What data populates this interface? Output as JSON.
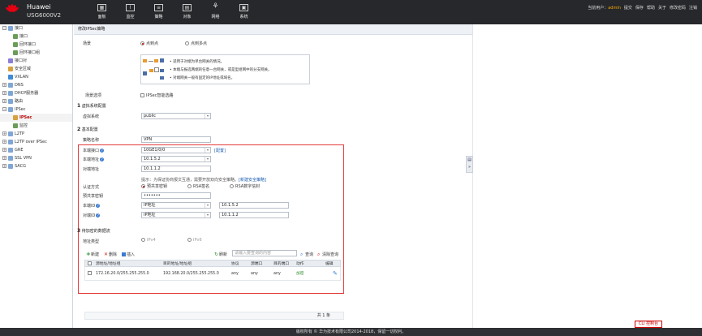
{
  "header": {
    "brand": "Huawei",
    "model": "USG6000V2",
    "nav": [
      {
        "label": "面板",
        "icon": "dashboard-icon"
      },
      {
        "label": "监控",
        "icon": "monitor-icon"
      },
      {
        "label": "策略",
        "icon": "policy-icon"
      },
      {
        "label": "对象",
        "icon": "object-icon"
      },
      {
        "label": "网络",
        "icon": "network-icon"
      },
      {
        "label": "系统",
        "icon": "system-icon"
      }
    ],
    "user_label": "当前用户：",
    "user_name": "admin",
    "links": [
      "提交",
      "保存",
      "帮助",
      "关于",
      "修改密码",
      "注销"
    ]
  },
  "sidebar": {
    "items": [
      {
        "label": "接口",
        "level": 0
      },
      {
        "label": "接口",
        "level": 1
      },
      {
        "label": "回环接口",
        "level": 1
      },
      {
        "label": "回环接口组",
        "level": 1
      },
      {
        "label": "接口对",
        "level": 0
      },
      {
        "label": "安全区域",
        "level": 0
      },
      {
        "label": "VXLAN",
        "level": 0
      },
      {
        "label": "DNS",
        "level": 0
      },
      {
        "label": "DHCP服务器",
        "level": 0
      },
      {
        "label": "路由",
        "level": 0
      },
      {
        "label": "IPSec",
        "level": 0
      },
      {
        "label": "IPSec",
        "level": 1
      },
      {
        "label": "监控",
        "level": 1
      },
      {
        "label": "L2TP",
        "level": 0
      },
      {
        "label": "L2TP over IPSec",
        "level": 0
      },
      {
        "label": "GRE",
        "level": 0
      },
      {
        "label": "SSL VPN",
        "level": 0
      },
      {
        "label": "SACG",
        "level": 0
      }
    ]
  },
  "form": {
    "panel_title": "修改IPSec策略",
    "scene_label": "场景",
    "scene_option1": "点到点",
    "scene_option2": "点到多点",
    "scene_desc": [
      "适用于对端为单台网关的情况。",
      "本端与报选两端的任意一台网关，或是型组网中的分支网关。",
      "对端网关一般有固定的IP地址或域名。"
    ],
    "scene_option_label": "场景选项",
    "smart_route_label": "IPSec智能选路",
    "section1": "虚拟系统配置",
    "vsys_label": "虚拟系统",
    "vsys_value": "public",
    "section2": "基本配置",
    "policy_name_label": "策略名称",
    "policy_name_value": "VPN",
    "local_if_label": "本端接口",
    "local_if_value": "10GE1/0/0",
    "config_link": "[配置]",
    "local_addr_label": "本端地址",
    "local_addr_value": "10.1.5.2",
    "peer_addr_label": "对端地址",
    "peer_addr_value": "10.1.1.2",
    "hint_text": "提示：为保证协商报文互通，需要开放双向安全策略。",
    "new_policy_link": "[新建安全策略]",
    "auth_label": "认证方式",
    "auth_options": [
      "预共享密钥",
      "RSA签名",
      "RSA数字信封"
    ],
    "psk_label": "预共享密钥",
    "psk_value": "•••••••",
    "local_id_label": "本端ID",
    "local_id_type": "IP地址",
    "local_id_value": "10.1.5.2",
    "peer_id_label": "对端ID",
    "peer_id_type": "IP地址",
    "peer_id_value": "10.1.1.2",
    "section3": "待加密的数据流",
    "addr_type_label": "地址类型",
    "addr_type_options": [
      "IPv4",
      "IPv6"
    ],
    "section_numbers": [
      "1",
      "2",
      "3"
    ]
  },
  "table": {
    "toolbar": {
      "new": "新建",
      "delete": "删除",
      "insert": "插入",
      "refresh": "刷新",
      "search_placeholder": "请输入要查询的内容",
      "query": "查询",
      "clear": "清除查询"
    },
    "columns": [
      "源地址/地址组",
      "目的地址/地址组",
      "协议",
      "源端口",
      "目的端口",
      "动作",
      "编辑"
    ],
    "rows": [
      {
        "src": "172.16.20.0/255.255.255.0",
        "dst": "192.168.20.0/255.255.255.0",
        "proto": "any",
        "sport": "any",
        "dport": "any",
        "action": "加密"
      }
    ],
    "footer": "共 1 条"
  },
  "footer_text": "版权所有 © 华为技术有限公司2014-2018，保留一切权利。",
  "cli_button": "CLI 控制台",
  "colors": {
    "header_bg": "#26282b",
    "accent_red": "#e33a3a",
    "link_blue": "#1a5cb0",
    "action_green": "#2a8a2a"
  }
}
